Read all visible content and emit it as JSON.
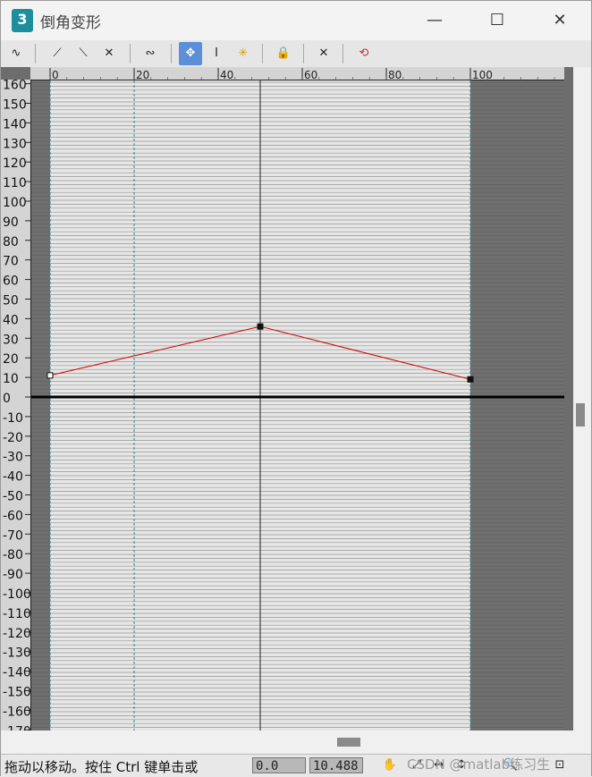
{
  "window": {
    "app_icon": "3",
    "title": "倒角变形",
    "minimize": "—",
    "maximize": "☐",
    "close": "✕"
  },
  "toolbar": {
    "items": [
      {
        "name": "scale-curve-icon",
        "glyph": "∿",
        "active": false
      },
      {
        "name": "linear-curve-icon",
        "glyph": "⟋",
        "active": false
      },
      {
        "name": "decay-curve-icon",
        "glyph": "⟍",
        "active": false
      },
      {
        "name": "cross-curve-icon",
        "glyph": "✕",
        "active": false
      },
      {
        "name": "wave-curve-icon",
        "glyph": "∾",
        "active": false
      },
      {
        "name": "move-control-point-icon",
        "glyph": "✥",
        "active": true
      },
      {
        "name": "scale-control-point-icon",
        "glyph": "I",
        "active": false
      },
      {
        "name": "insert-corner-point-icon",
        "glyph": "✳",
        "active": false
      },
      {
        "name": "lock-icon",
        "glyph": "🔒",
        "active": false
      },
      {
        "name": "delete-control-point-icon",
        "glyph": "✕",
        "active": false
      },
      {
        "name": "reset-curve-icon",
        "glyph": "⟲",
        "active": false
      }
    ]
  },
  "ruler": {
    "x_ticks": [
      "0",
      "20",
      "40",
      "60",
      "80",
      "100"
    ],
    "y_ticks": [
      "160",
      "150",
      "140",
      "130",
      "120",
      "110",
      "100",
      "90",
      "80",
      "70",
      "60",
      "50",
      "40",
      "30",
      "20",
      "10",
      "0",
      "-10",
      "-20",
      "-30",
      "-40",
      "-50",
      "-60",
      "-70",
      "-80",
      "-90",
      "-100",
      "-110",
      "-120",
      "-130",
      "-140",
      "-150",
      "-160",
      "-170"
    ]
  },
  "curve": {
    "color": "#cc0000",
    "points": [
      {
        "x": 0,
        "y": 11
      },
      {
        "x": 50,
        "y": 36
      },
      {
        "x": 100,
        "y": 9
      }
    ]
  },
  "status": {
    "message": "拖动以移动。按住 Ctrl 键单击或",
    "field1": "0.0",
    "field2": "10.488",
    "icons": [
      "pan-icon",
      "zoom-extents-icon",
      "zoom-horizontal-icon",
      "zoom-vertical-icon",
      "zoom-icon",
      "zoom-region-icon"
    ],
    "watermark": "CSDN @matlab练习生"
  }
}
